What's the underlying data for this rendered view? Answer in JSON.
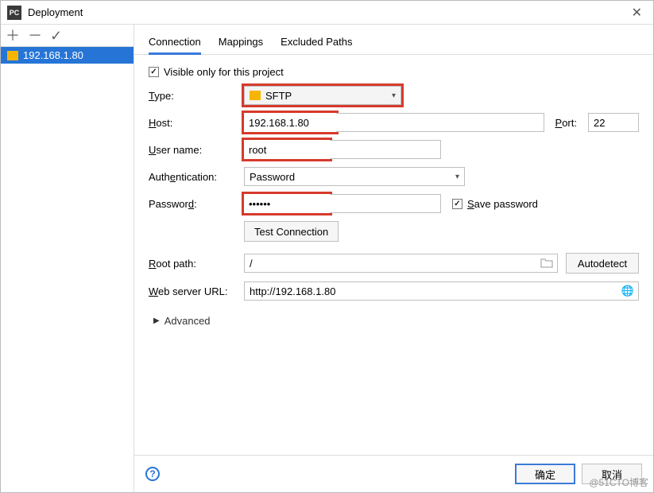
{
  "window": {
    "title": "Deployment"
  },
  "sidebar": {
    "server": "192.168.1.80"
  },
  "tabs": {
    "t0": "Connection",
    "t1": "Mappings",
    "t2": "Excluded Paths"
  },
  "form": {
    "visible_only_label": "Visible only for this project",
    "type_label": "Type:",
    "type_value": "SFTP",
    "host_label": "Host:",
    "host_value": "192.168.1.80",
    "port_label": "Port:",
    "port_value": "22",
    "user_label": "User name:",
    "user_value": "root",
    "auth_label": "Authentication:",
    "auth_value": "Password",
    "pass_label": "Password:",
    "pass_value": "••••••",
    "save_pass_label": "Save password",
    "test_conn": "Test Connection",
    "root_label": "Root path:",
    "root_value": "/",
    "autodetect": "Autodetect",
    "web_label": "Web server URL:",
    "web_value": "http://192.168.1.80",
    "advanced": "Advanced"
  },
  "footer": {
    "ok": "确定",
    "cancel": "取消"
  },
  "watermark": "@51CTO博客"
}
